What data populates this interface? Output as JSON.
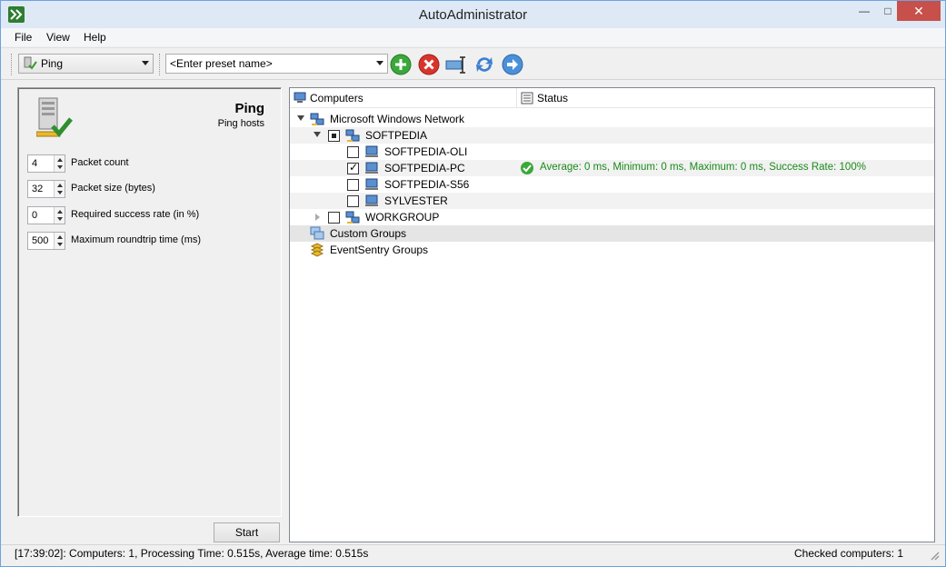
{
  "window": {
    "title": "AutoAdministrator"
  },
  "menu": {
    "items": [
      "File",
      "View",
      "Help"
    ]
  },
  "toolbar": {
    "plugin_selected": "Ping",
    "preset_placeholder": "<Enter preset name>",
    "buttons": [
      "add-preset",
      "delete-preset",
      "rename-preset",
      "refresh",
      "forward"
    ]
  },
  "plugin": {
    "title": "Ping",
    "subtitle": "Ping hosts",
    "params": [
      {
        "value": "4",
        "label": "Packet count"
      },
      {
        "value": "32",
        "label": "Packet size (bytes)"
      },
      {
        "value": "0",
        "label": "Required success rate (in %)"
      },
      {
        "value": "500",
        "label": "Maximum roundtrip time (ms)"
      }
    ],
    "start_label": "Start"
  },
  "tree": {
    "columns": [
      "Computers",
      "Status"
    ],
    "nodes": [
      {
        "label": "Microsoft Windows Network",
        "expanded": true
      },
      {
        "label": "SOFTPEDIA",
        "checkbox": "partial",
        "expanded": true
      },
      {
        "label": "SOFTPEDIA-OLI",
        "checkbox": "unchecked"
      },
      {
        "label": "SOFTPEDIA-PC",
        "checkbox": "checked",
        "status": "Average: 0 ms, Minimum: 0 ms, Maximum: 0 ms, Success Rate: 100%"
      },
      {
        "label": "SOFTPEDIA-S56",
        "checkbox": "unchecked"
      },
      {
        "label": "SYLVESTER",
        "checkbox": "unchecked"
      },
      {
        "label": "WORKGROUP",
        "checkbox": "unchecked",
        "expanded": false
      },
      {
        "label": "Custom Groups",
        "selected": true
      },
      {
        "label": "EventSentry Groups"
      }
    ]
  },
  "statusbar": {
    "left": "[17:39:02]: Computers: 1, Processing Time: 0.515s, Average time: 0.515s",
    "right": "Checked computers: 1"
  },
  "colors": {
    "status_ok": "#1a8a1a",
    "add_button": "#3aa83a",
    "delete_button": "#d9342b",
    "forward_button": "#4a90d9"
  }
}
